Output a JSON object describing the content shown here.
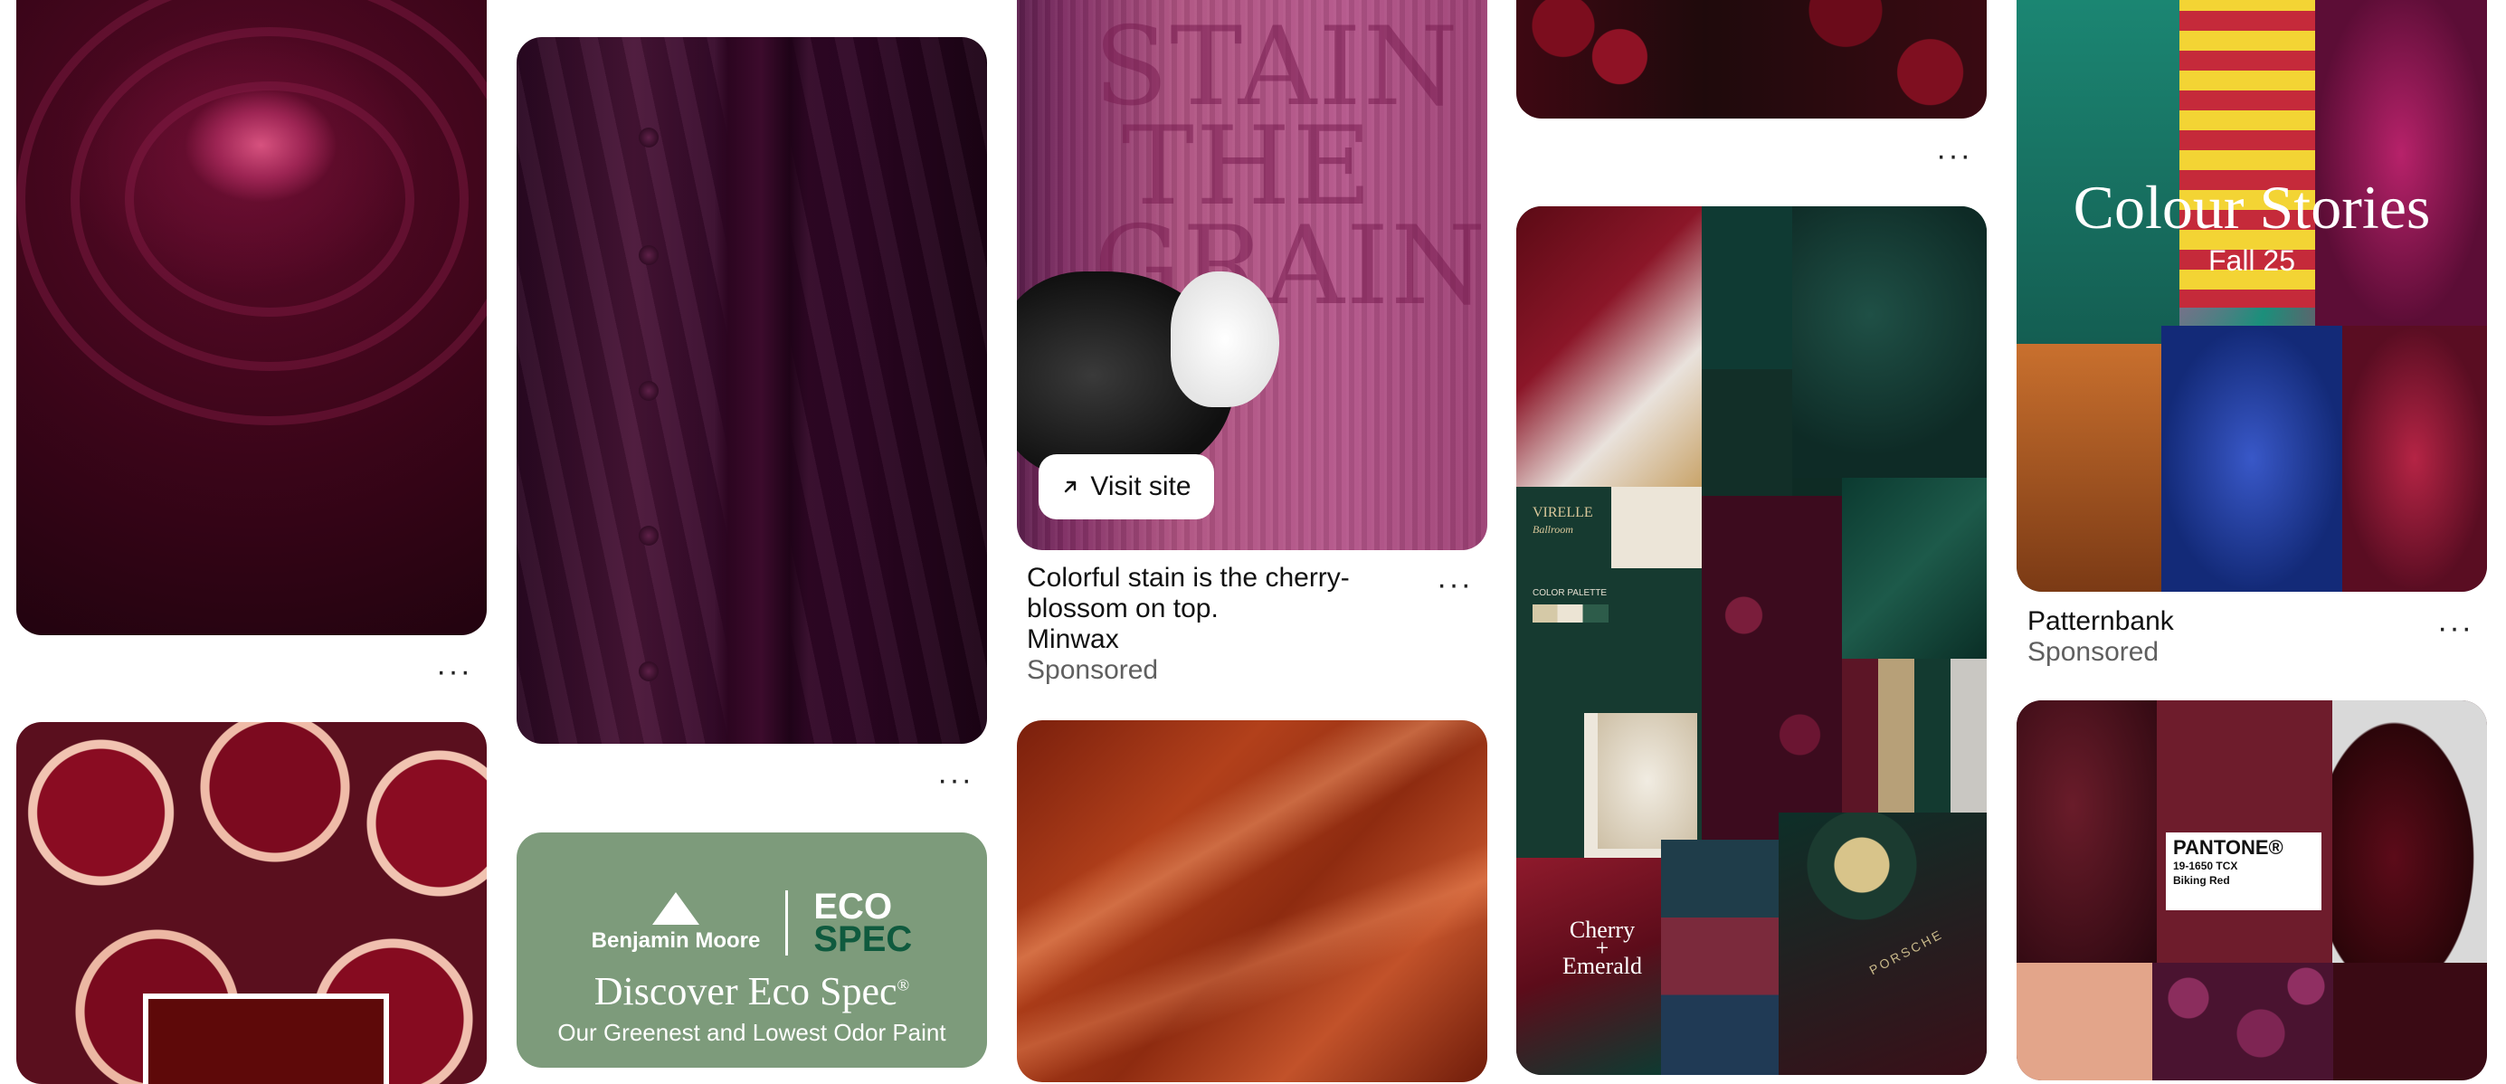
{
  "colors": {
    "background": "#ffffff",
    "sponsored_text": "#5f5f5f",
    "burgundy": "#6e1c2c",
    "eco_green": "#7d9b7b"
  },
  "more_icon": "more-horizontal-icon",
  "pins": {
    "rose": {},
    "pomegranate": {},
    "velvet": {},
    "eco_spec_ad": {
      "brand": "Benjamin Moore",
      "product_line1": "ECO",
      "product_line2": "SPEC",
      "headline": "Discover Eco Spec",
      "trademark": "®",
      "subline": "Our Greenest and Lowest Odor Paint"
    },
    "minwax_ad": {
      "image_text": [
        "STAIN",
        "THE",
        "GRAIN"
      ],
      "visit_label": "Visit site",
      "visit_icon": "arrow-up-right-icon",
      "title": "Colorful stain is the cherry-blossom on top.",
      "source": "Minwax",
      "sponsored": "Sponsored"
    },
    "satin": {},
    "cherries": {},
    "moodboard": {
      "brand_top": "VIRELLE",
      "brand_tag": "Ballroom",
      "palette_label": "COLOR PALETTE",
      "caption": [
        "Cherry",
        "+",
        "Emerald"
      ],
      "watch_brand": "PORSCHE"
    },
    "patternbank_ad": {
      "title": "Colour Stories",
      "subtitle": "Fall 25",
      "source": "Patternbank",
      "sponsored": "Sponsored"
    },
    "pantone": {
      "brand": "PANTONE®",
      "code": "19-1650 TCX",
      "name": "Biking Red"
    }
  }
}
